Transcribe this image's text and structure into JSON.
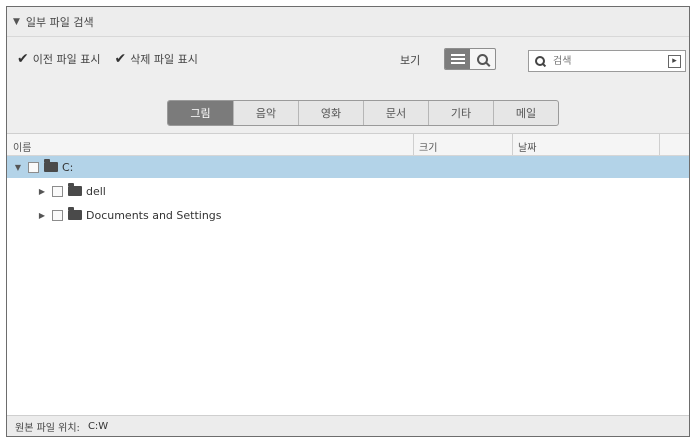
{
  "panel": {
    "title": "일부 파일 검색"
  },
  "options": {
    "show_previous": {
      "label": "이전 파일 표시",
      "checked": true
    },
    "show_deleted": {
      "label": "삭제 파일 표시",
      "checked": true
    }
  },
  "view": {
    "label": "보기",
    "modes": [
      "list",
      "search"
    ],
    "active": "list"
  },
  "search": {
    "placeholder": "검색"
  },
  "categories": {
    "tabs": [
      "그림",
      "음악",
      "영화",
      "문서",
      "기타",
      "메일"
    ],
    "active_index": 0
  },
  "columns": {
    "name": "이름",
    "size": "크기",
    "date": "날짜"
  },
  "tree": {
    "root": {
      "label": "C:",
      "expanded": true,
      "selected": true
    },
    "children": [
      {
        "label": "dell",
        "expanded": false
      },
      {
        "label": "Documents and Settings",
        "expanded": false
      }
    ]
  },
  "status": {
    "label": "원본 파일 위치:",
    "value": "C:W"
  },
  "colors": {
    "selected_row": "#b3d3e8",
    "active_tab": "#7b7b7b"
  }
}
